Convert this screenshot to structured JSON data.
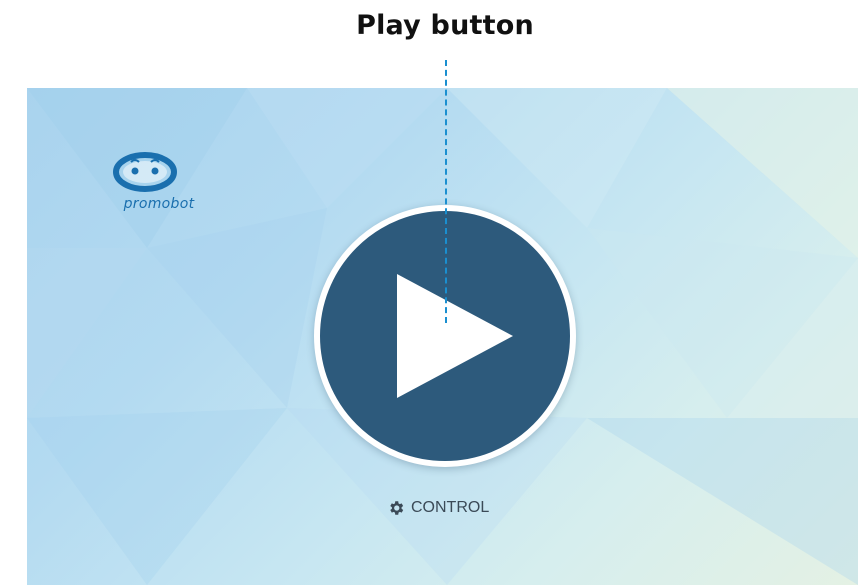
{
  "annotation": {
    "title": "Play button",
    "line_color": "#1a8fd0"
  },
  "app": {
    "logo_text": "promobot",
    "logo_color": "#1a6fae",
    "play_button": {
      "icon": "play-icon",
      "fill_color": "#2d5a7c",
      "ring_color": "#ffffff"
    },
    "control": {
      "icon": "gear-icon",
      "label": "CONTROL"
    }
  }
}
